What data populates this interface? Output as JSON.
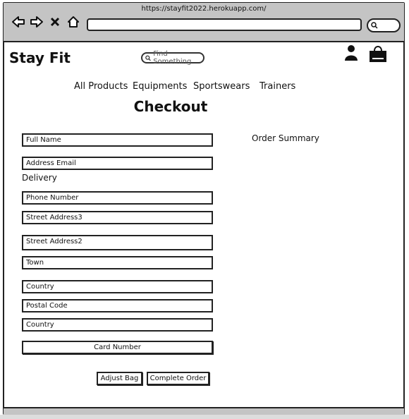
{
  "browser": {
    "url": "https://stayfit2022.herokuapp.com/"
  },
  "header": {
    "brand": "Stay Fit",
    "search_placeholder": "Find Something"
  },
  "nav": {
    "items": [
      "All Products",
      "Equipments",
      "Sportswears",
      "Trainers"
    ]
  },
  "page": {
    "title": "Checkout",
    "order_summary": "Order Summary",
    "delivery_label": "Delivery"
  },
  "form": {
    "full_name": "Full Name",
    "email": "Address Email",
    "phone": "Phone Number",
    "street3": "Street Address3",
    "street2": "Street Address2",
    "town": "Town",
    "country1": "Country",
    "postal": "Postal Code",
    "country2": "Country",
    "card": "Card Number"
  },
  "buttons": {
    "adjust": "Adjust Bag",
    "complete": "Complete Order"
  }
}
